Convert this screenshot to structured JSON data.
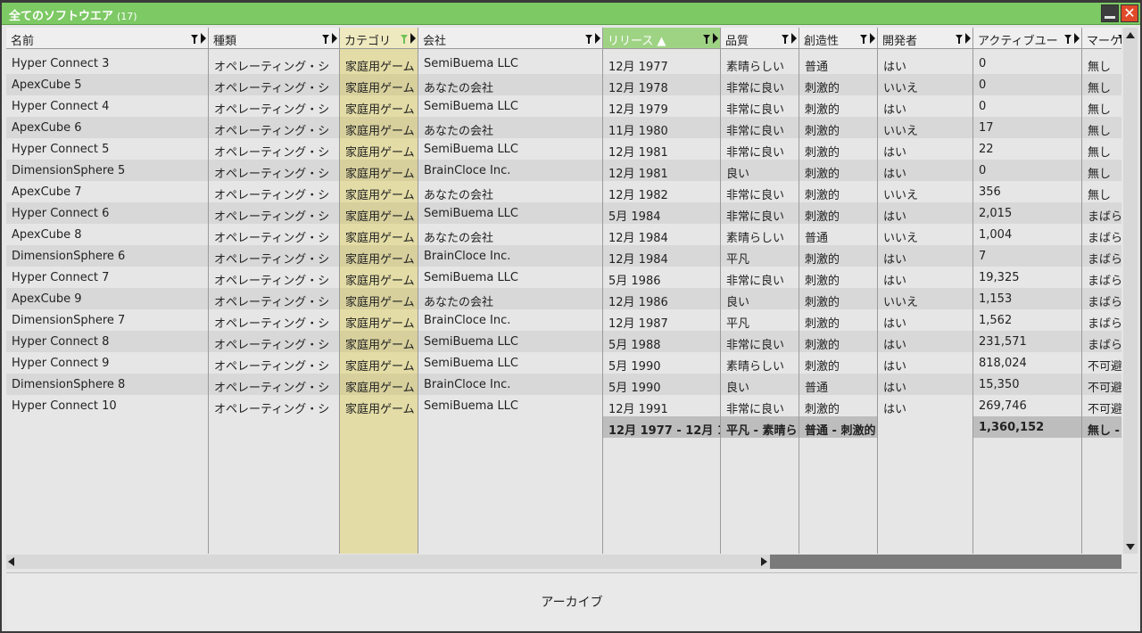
{
  "window": {
    "title": "全てのソフトウエア",
    "count": "(17)",
    "minimize_icon": "minimize-icon",
    "close_icon": "close-icon",
    "close_symbol": "✕"
  },
  "columns": [
    {
      "header": "名前"
    },
    {
      "header": "種類"
    },
    {
      "header": "カテゴリ"
    },
    {
      "header": "会社"
    },
    {
      "header": "リリース ▲"
    },
    {
      "header": "品質"
    },
    {
      "header": "創造性"
    },
    {
      "header": "開発者"
    },
    {
      "header": "アクティブユー"
    },
    {
      "header": "マーケ"
    }
  ],
  "rows": [
    [
      "Hyper Connect 3",
      "オペレーティング・シ",
      "家庭用ゲーム",
      "SemiBuema LLC",
      "12月 1977",
      "素晴らしい",
      "普通",
      "はい",
      "0",
      "無し"
    ],
    [
      "ApexCube 5",
      "オペレーティング・シ",
      "家庭用ゲーム",
      "あなたの会社",
      "12月 1978",
      "非常に良い",
      "刺激的",
      "いいえ",
      "0",
      "無し"
    ],
    [
      "Hyper Connect 4",
      "オペレーティング・シ",
      "家庭用ゲーム",
      "SemiBuema LLC",
      "12月 1979",
      "非常に良い",
      "刺激的",
      "はい",
      "0",
      "無し"
    ],
    [
      "ApexCube 6",
      "オペレーティング・シ",
      "家庭用ゲーム",
      "あなたの会社",
      "11月 1980",
      "非常に良い",
      "刺激的",
      "いいえ",
      "17",
      "無し"
    ],
    [
      "Hyper Connect 5",
      "オペレーティング・シ",
      "家庭用ゲーム",
      "SemiBuema LLC",
      "12月 1981",
      "非常に良い",
      "刺激的",
      "はい",
      "22",
      "無し"
    ],
    [
      "DimensionSphere 5",
      "オペレーティング・シ",
      "家庭用ゲーム",
      "BrainCloce Inc.",
      "12月 1981",
      "良い",
      "刺激的",
      "はい",
      "0",
      "無し"
    ],
    [
      "ApexCube 7",
      "オペレーティング・シ",
      "家庭用ゲーム",
      "あなたの会社",
      "12月 1982",
      "非常に良い",
      "刺激的",
      "いいえ",
      "356",
      "無し"
    ],
    [
      "Hyper Connect 6",
      "オペレーティング・シ",
      "家庭用ゲーム",
      "SemiBuema LLC",
      "5月 1984",
      "非常に良い",
      "刺激的",
      "はい",
      "2,015",
      "まばら"
    ],
    [
      "ApexCube 8",
      "オペレーティング・シ",
      "家庭用ゲーム",
      "あなたの会社",
      "12月 1984",
      "素晴らしい",
      "普通",
      "いいえ",
      "1,004",
      "まばら"
    ],
    [
      "DimensionSphere 6",
      "オペレーティング・シ",
      "家庭用ゲーム",
      "BrainCloce Inc.",
      "12月 1984",
      "平凡",
      "刺激的",
      "はい",
      "7",
      "まばら"
    ],
    [
      "Hyper Connect 7",
      "オペレーティング・シ",
      "家庭用ゲーム",
      "SemiBuema LLC",
      "5月 1986",
      "非常に良い",
      "刺激的",
      "はい",
      "19,325",
      "まばら"
    ],
    [
      "ApexCube 9",
      "オペレーティング・シ",
      "家庭用ゲーム",
      "あなたの会社",
      "12月 1986",
      "良い",
      "刺激的",
      "いいえ",
      "1,153",
      "まばら"
    ],
    [
      "DimensionSphere 7",
      "オペレーティング・シ",
      "家庭用ゲーム",
      "BrainCloce Inc.",
      "12月 1987",
      "平凡",
      "刺激的",
      "はい",
      "1,562",
      "まばら"
    ],
    [
      "Hyper Connect 8",
      "オペレーティング・シ",
      "家庭用ゲーム",
      "SemiBuema LLC",
      "5月 1988",
      "非常に良い",
      "刺激的",
      "はい",
      "231,571",
      "まばら"
    ],
    [
      "Hyper Connect 9",
      "オペレーティング・シ",
      "家庭用ゲーム",
      "SemiBuema LLC",
      "5月 1990",
      "素晴らしい",
      "刺激的",
      "はい",
      "818,024",
      "不可避"
    ],
    [
      "DimensionSphere 8",
      "オペレーティング・シ",
      "家庭用ゲーム",
      "BrainCloce Inc.",
      "5月 1990",
      "良い",
      "普通",
      "はい",
      "15,350",
      "不可避"
    ],
    [
      "Hyper Connect 10",
      "オペレーティング・シ",
      "家庭用ゲーム",
      "SemiBuema LLC",
      "12月 1991",
      "非常に良い",
      "刺激的",
      "はい",
      "269,746",
      "不可避"
    ]
  ],
  "summary": [
    "",
    "",
    "",
    "",
    "12月 1977 - 12月 1991",
    "平凡 - 素晴らしい",
    "普通 - 刺激的",
    "",
    "1,360,152",
    "無し - 不可避"
  ],
  "footer": {
    "archive_label": "アーカイブ"
  },
  "colors": {
    "titlebar": "#7dc964",
    "sorted_header": "#9fd384",
    "category_column": "#e3dca6",
    "close_button": "#e04a2a"
  }
}
